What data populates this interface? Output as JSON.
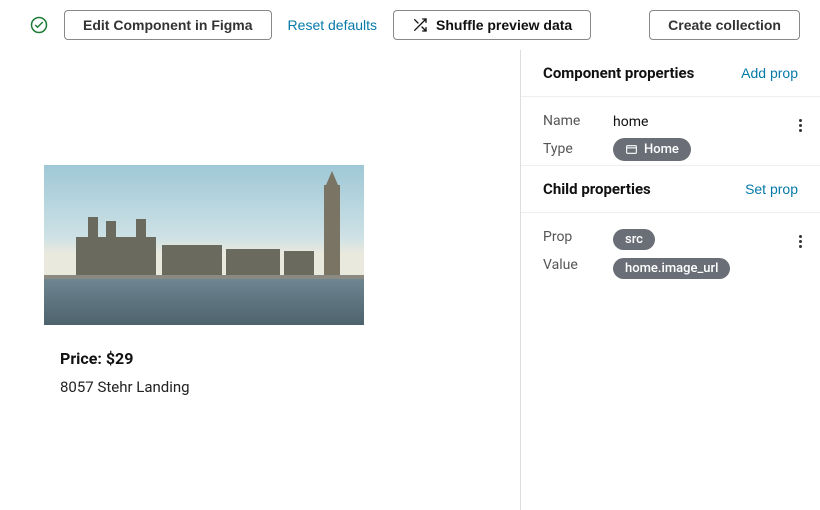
{
  "toolbar": {
    "edit_label": "Edit Component in Figma",
    "reset_label": "Reset defaults",
    "shuffle_label": "Shuffle preview data",
    "create_label": "Create collection"
  },
  "preview": {
    "price_label": "Price: $29",
    "address": "8057 Stehr Landing"
  },
  "panel": {
    "component_header": "Component properties",
    "add_prop_label": "Add prop",
    "name_label": "Name",
    "name_value": "home",
    "type_label": "Type",
    "type_chip": "Home",
    "child_header": "Child properties",
    "set_prop_label": "Set prop",
    "prop_label": "Prop",
    "prop_chip": "src",
    "value_label": "Value",
    "value_chip": "home.image_url"
  }
}
